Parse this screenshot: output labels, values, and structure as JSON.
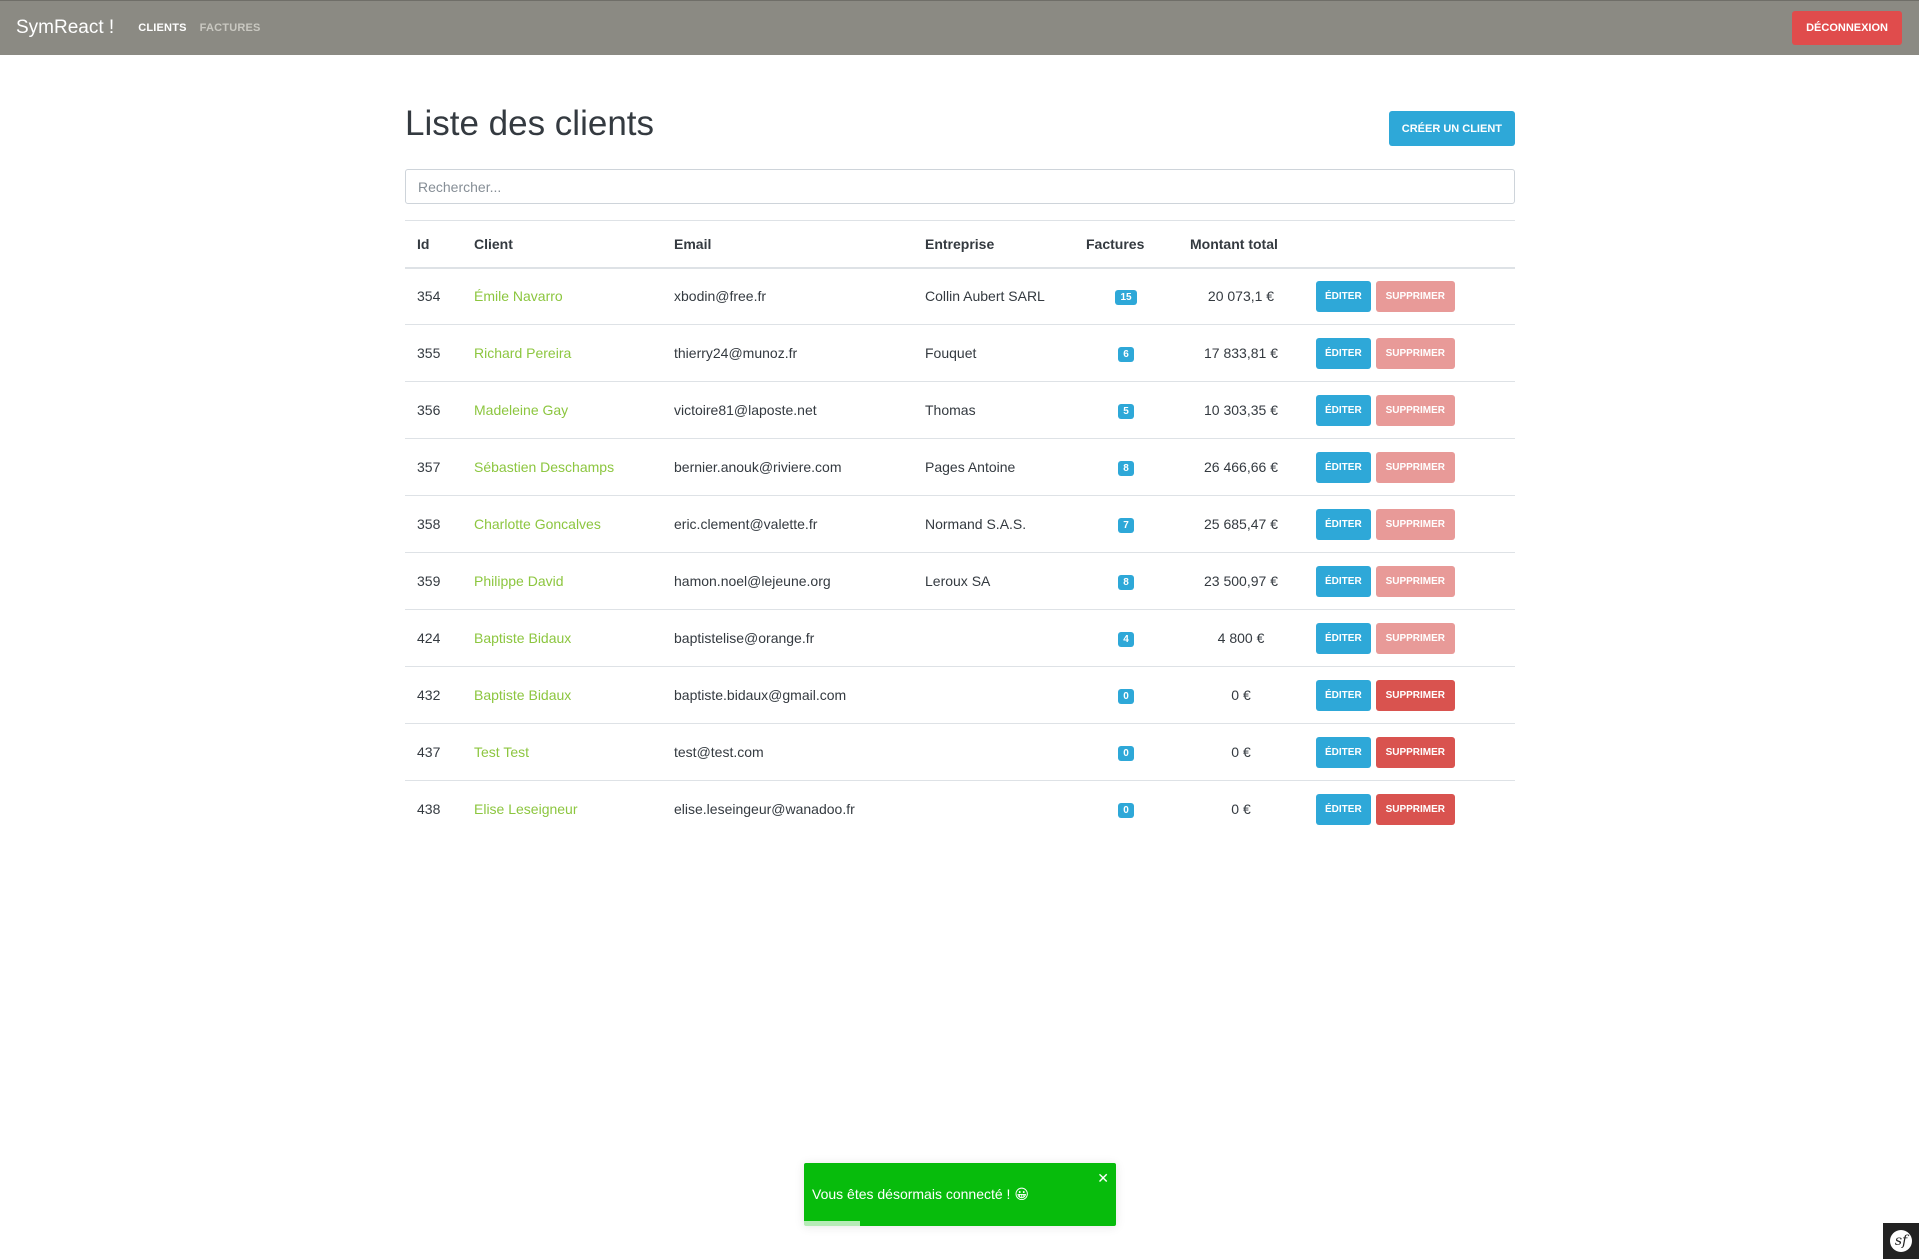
{
  "navbar": {
    "brand": "SymReact !",
    "links": [
      {
        "label": "Clients"
      },
      {
        "label": "Factures"
      }
    ],
    "logout_label": "Déconnexion"
  },
  "page": {
    "title": "Liste des clients",
    "create_label": "Créer un client"
  },
  "search": {
    "placeholder": "Rechercher..."
  },
  "table": {
    "headers": [
      "Id",
      "Client",
      "Email",
      "Entreprise",
      "Factures",
      "Montant total"
    ],
    "edit_label": "Éditer",
    "delete_label": "Supprimer",
    "rows": [
      {
        "id": "354",
        "client": "Émile Navarro",
        "email": "xbodin@free.fr",
        "company": "Collin Aubert SARL",
        "invoices": "15",
        "total": "20 073,1 €",
        "delete_disabled": true
      },
      {
        "id": "355",
        "client": "Richard Pereira",
        "email": "thierry24@munoz.fr",
        "company": "Fouquet",
        "invoices": "6",
        "total": "17 833,81 €",
        "delete_disabled": true
      },
      {
        "id": "356",
        "client": "Madeleine Gay",
        "email": "victoire81@laposte.net",
        "company": "Thomas",
        "invoices": "5",
        "total": "10 303,35 €",
        "delete_disabled": true
      },
      {
        "id": "357",
        "client": "Sébastien Deschamps",
        "email": "bernier.anouk@riviere.com",
        "company": "Pages Antoine",
        "invoices": "8",
        "total": "26 466,66 €",
        "delete_disabled": true
      },
      {
        "id": "358",
        "client": "Charlotte Goncalves",
        "email": "eric.clement@valette.fr",
        "company": "Normand S.A.S.",
        "invoices": "7",
        "total": "25 685,47 €",
        "delete_disabled": true
      },
      {
        "id": "359",
        "client": "Philippe David",
        "email": "hamon.noel@lejeune.org",
        "company": "Leroux SA",
        "invoices": "8",
        "total": "23 500,97 €",
        "delete_disabled": true
      },
      {
        "id": "424",
        "client": "Baptiste Bidaux",
        "email": "baptistelise@orange.fr",
        "company": "",
        "invoices": "4",
        "total": "4 800 €",
        "delete_disabled": true
      },
      {
        "id": "432",
        "client": "Baptiste Bidaux",
        "email": "baptiste.bidaux@gmail.com",
        "company": "",
        "invoices": "0",
        "total": "0 €",
        "delete_disabled": false
      },
      {
        "id": "437",
        "client": "Test Test",
        "email": "test@test.com",
        "company": "",
        "invoices": "0",
        "total": "0 €",
        "delete_disabled": false
      },
      {
        "id": "438",
        "client": "Elise Leseigneur",
        "email": "elise.leseingeur@wanadoo.fr",
        "company": "",
        "invoices": "0",
        "total": "0 €",
        "delete_disabled": false
      }
    ]
  },
  "toast": {
    "message": "Vous êtes désormais connecté ! 😀",
    "close": "✕",
    "progress": 0.18
  },
  "colors": {
    "navbar": "#8b8a83",
    "primary": "#2ea8d8",
    "danger": "#d9534f",
    "danger_disabled": "#e89a98",
    "client_link": "#8cc63f",
    "toast": "#07bc0c"
  },
  "icons": {
    "toast_close": "close-icon",
    "debug_toolbar": "symfony-logo-icon"
  }
}
